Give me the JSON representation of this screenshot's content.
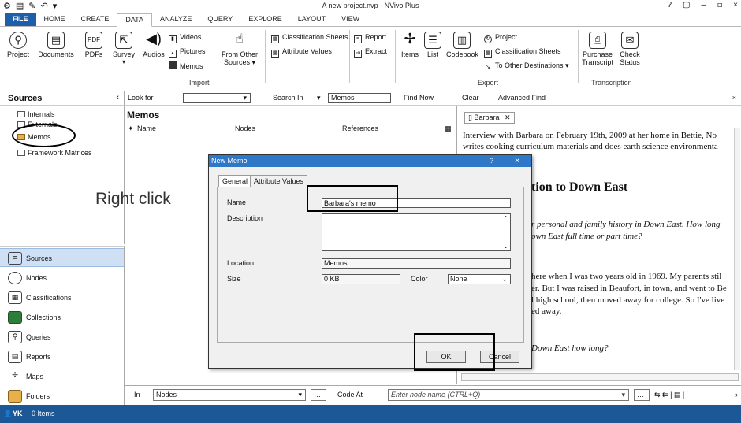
{
  "window": {
    "title": "A new project.nvp - NVivo Plus",
    "controls": [
      "?",
      "▢",
      "–",
      "⧉",
      "×"
    ]
  },
  "ribbon_tabs": [
    "FILE",
    "HOME",
    "CREATE",
    "DATA",
    "ANALYZE",
    "QUERY",
    "EXPLORE",
    "LAYOUT",
    "VIEW"
  ],
  "ribbon": {
    "project": "Project",
    "documents": "Documents",
    "pdfs": "PDFs",
    "survey": "Survey",
    "audios": "Audios",
    "videos": "Videos",
    "pictures": "Pictures",
    "memos": "Memos",
    "from_other_sources_1": "From Other",
    "from_other_sources_2": "Sources ▾",
    "import_group": "Import",
    "classification_sheets": "Classification Sheets",
    "attribute_values": "Attribute Values",
    "report": "Report",
    "extract": "Extract",
    "items": "Items",
    "list": "List",
    "codebook": "Codebook",
    "export_project": "Project",
    "export_classification_sheets": "Classification Sheets",
    "to_other_destinations": "To Other Destinations ▾",
    "export_group": "Export",
    "purchase_1": "Purchase",
    "purchase_2": "Transcript",
    "check_1": "Check",
    "check_2": "Status",
    "transcription_group": "Transcription"
  },
  "nav": {
    "header": "Sources",
    "tree": [
      "Internals",
      "Externals",
      "Memos",
      "Framework Matrices"
    ],
    "items": [
      "Sources",
      "Nodes",
      "Classifications",
      "Collections",
      "Queries",
      "Reports",
      "Maps",
      "Folders"
    ]
  },
  "findbar": {
    "look_for": "Look for",
    "search_in": "Search In",
    "search_in_value": "Memos",
    "find_now": "Find Now",
    "clear": "Clear",
    "advanced_find": "Advanced Find"
  },
  "listview": {
    "title": "Memos",
    "columns": [
      "Name",
      "Nodes",
      "References"
    ]
  },
  "detail": {
    "tab": "Barbara",
    "lines": [
      "Interview with Barbara on February 19th, 2009 at her home in Bettie, No",
      "writes cooking curriculum materials and does earth science environmenta",
      "tion to Down East",
      "r personal and family history in Down East. How long",
      "own East full time or part time?",
      "here when I was two years old in 1969. My parents stil",
      "er. But I was raised in Beaufort, in town, and went to Be",
      "l high school, then moved away for college. So I've live",
      "ed away.",
      "Down East how long?"
    ]
  },
  "annotation": {
    "right_click": "Right click"
  },
  "codebar": {
    "in": "In",
    "in_value": "Nodes",
    "code_at": "Code At",
    "node_placeholder": "Enter node name (CTRL+Q)"
  },
  "status": {
    "user": "YK",
    "items": "0 Items"
  },
  "dialog": {
    "title": "New Memo",
    "help": "?",
    "close": "✕",
    "tabs": [
      "General",
      "Attribute Values"
    ],
    "name_label": "Name",
    "name_value": "Barbara's memo",
    "description_label": "Description",
    "location_label": "Location",
    "location_value": "Memos",
    "size_label": "Size",
    "size_value": "0 KB",
    "color_label": "Color",
    "color_value": "None",
    "ok": "OK",
    "cancel": "Cancel"
  }
}
